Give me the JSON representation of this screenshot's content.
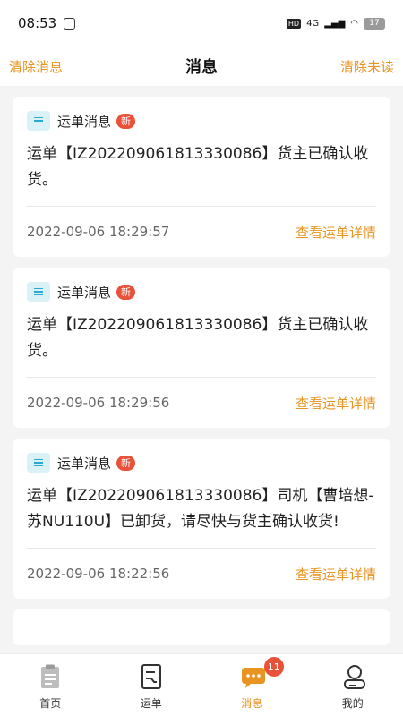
{
  "status_bar": {
    "time": "08:53",
    "network": "4G",
    "hd": "HD",
    "battery": "17"
  },
  "nav": {
    "left_action": "清除消息",
    "title": "消息",
    "right_action": "清除未读"
  },
  "messages": [
    {
      "type": "运单消息",
      "badge": "新",
      "text": "运单【IZ202209061813330086】货主已确认收货。",
      "time": "2022-09-06 18:29:57",
      "link": "查看运单详情"
    },
    {
      "type": "运单消息",
      "badge": "新",
      "text": "运单【IZ202209061813330086】货主已确认收货。",
      "time": "2022-09-06 18:29:56",
      "link": "查看运单详情"
    },
    {
      "type": "运单消息",
      "badge": "新",
      "text": "运单【IZ202209061813330086】司机【曹培想-苏NU110U】已卸货，请尽快与货主确认收货!",
      "time": "2022-09-06 18:22:56",
      "link": "查看运单详情"
    }
  ],
  "tabs": [
    {
      "label": "首页",
      "icon": "clipboard-icon"
    },
    {
      "label": "运单",
      "icon": "waybill-icon"
    },
    {
      "label": "消息",
      "icon": "chat-icon",
      "badge": "11"
    },
    {
      "label": "我的",
      "icon": "profile-icon"
    }
  ],
  "colors": {
    "accent": "#e89422",
    "badge": "#e8523a",
    "icon_bg": "#d9f1f7"
  }
}
